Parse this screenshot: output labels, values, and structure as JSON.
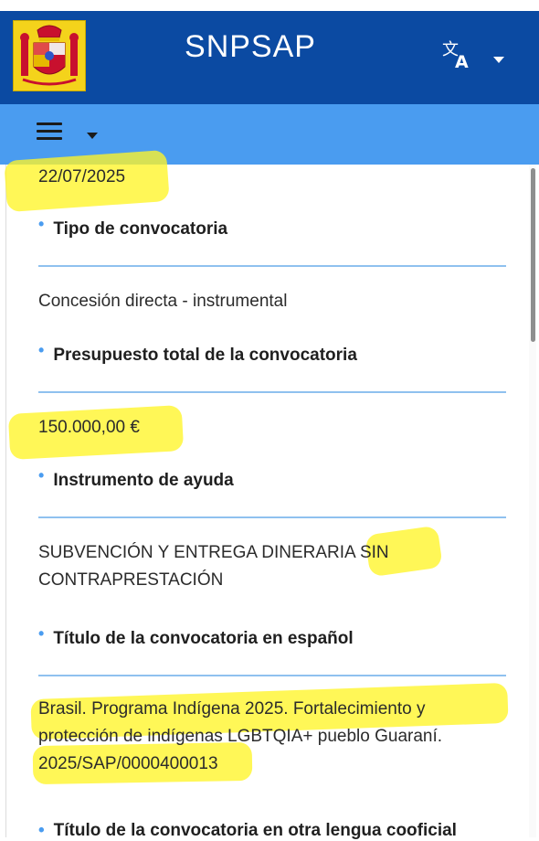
{
  "header": {
    "app_title": "SNPSAP",
    "logo_icon": "spain-coat-of-arms-icon",
    "translate_icon": "translate-icon"
  },
  "nav": {
    "menu_icon": "hamburger-menu-icon"
  },
  "fields": [
    {
      "value": "22/07/2025"
    },
    {
      "label": "Tipo de convocatoria",
      "value": "Concesión directa - instrumental"
    },
    {
      "label": "Presupuesto total de la convocatoria",
      "value": "150.000,00 €"
    },
    {
      "label": "Instrumento de ayuda",
      "value_lines": [
        "SUBVENCIÓN Y ENTREGA DINERARIA SIN",
        "CONTRAPRESTACIÓN"
      ]
    },
    {
      "label": "Título de la convocatoria en español",
      "value_lines": [
        "Brasil. Programa Indígena 2025. Fortalecimiento y",
        "protección de indígenas LGBTQIA+ pueblo Guaraní.",
        "2025/SAP/0000400013"
      ]
    },
    {
      "label": "Título de la convocatoria en otra lengua cooficial"
    }
  ],
  "colors": {
    "header_bg": "#0b4aa2",
    "nav_bg": "#4a9cf0",
    "divider": "#8fc1ef",
    "highlight": "#fff528"
  }
}
